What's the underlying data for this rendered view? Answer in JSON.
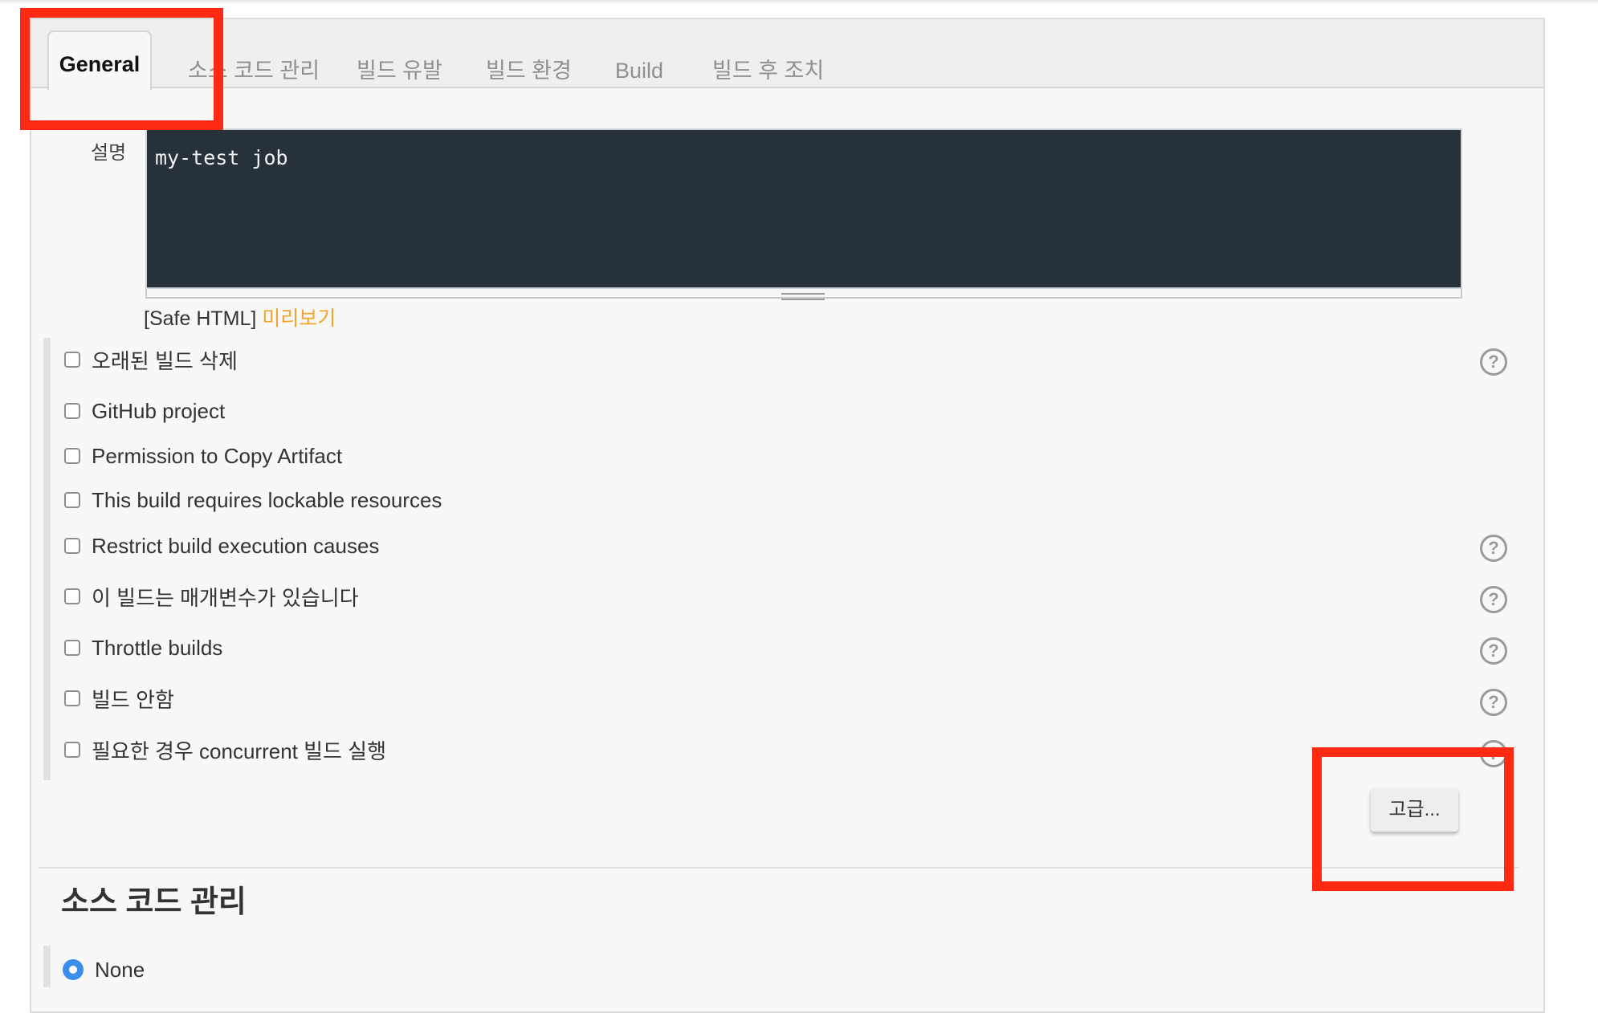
{
  "tabs": [
    {
      "label": "General",
      "active": true
    },
    {
      "label": "소스 코드 관리"
    },
    {
      "label": "빌드 유발"
    },
    {
      "label": "빌드 환경"
    },
    {
      "label": "Build"
    },
    {
      "label": "빌드 후 조치"
    }
  ],
  "description": {
    "label": "설명",
    "value": "my-test job",
    "safe_html_label": "[Safe HTML]",
    "preview_link": "미리보기"
  },
  "options": [
    {
      "label": "오래된 빌드 삭제",
      "checked": false,
      "help": true
    },
    {
      "label": "GitHub project",
      "checked": false,
      "help": false
    },
    {
      "label": "Permission to Copy Artifact",
      "checked": false,
      "help": false
    },
    {
      "label": "This build requires lockable resources",
      "checked": false,
      "help": false
    },
    {
      "label": "Restrict build execution causes",
      "checked": false,
      "help": true
    },
    {
      "label": "이 빌드는 매개변수가 있습니다",
      "checked": false,
      "help": true
    },
    {
      "label": "Throttle builds",
      "checked": false,
      "help": true
    },
    {
      "label": "빌드 안함",
      "checked": false,
      "help": true
    },
    {
      "label": "필요한 경우 concurrent 빌드 실행",
      "checked": false,
      "help": true
    }
  ],
  "help_icon_glyph": "?",
  "advanced_button": "고급...",
  "scm_section": {
    "title": "소스 코드 관리",
    "selected_option": "None"
  },
  "colors": {
    "highlight_box": "#ff2a12",
    "editor_bg": "#27313a",
    "preview_link": "#f3a52a",
    "radio_selected": "#3b8eea"
  }
}
